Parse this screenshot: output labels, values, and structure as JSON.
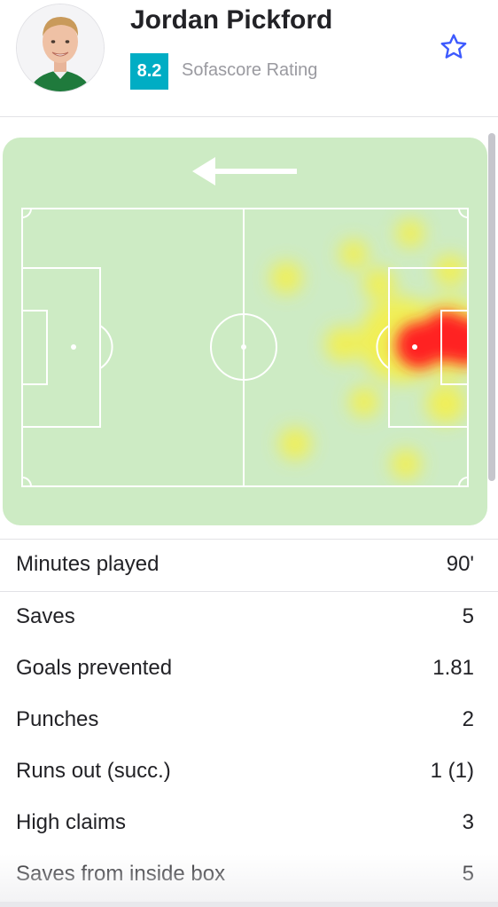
{
  "player": {
    "name": "Jordan Pickford",
    "rating": "8.2",
    "rating_label": "Sofascore Rating",
    "favorite_icon": "star-outline-icon"
  },
  "heatmap": {
    "direction_icon": "arrow-left-icon",
    "colors": {
      "pitch": "#cdebc4",
      "low": "#f5f04a",
      "high": "#ff2020"
    }
  },
  "stats": [
    {
      "label": "Minutes played",
      "value": "90'"
    },
    {
      "label": "Saves",
      "value": "5"
    },
    {
      "label": "Goals prevented",
      "value": "1.81"
    },
    {
      "label": "Punches",
      "value": "2"
    },
    {
      "label": "Runs out (succ.)",
      "value": "1 (1)"
    },
    {
      "label": "High claims",
      "value": "3"
    },
    {
      "label": "Saves from inside box",
      "value": "5"
    }
  ],
  "colors": {
    "accent": "#00adc4",
    "star": "#3d5afe",
    "text": "#222226",
    "muted": "#9a9aa0"
  }
}
